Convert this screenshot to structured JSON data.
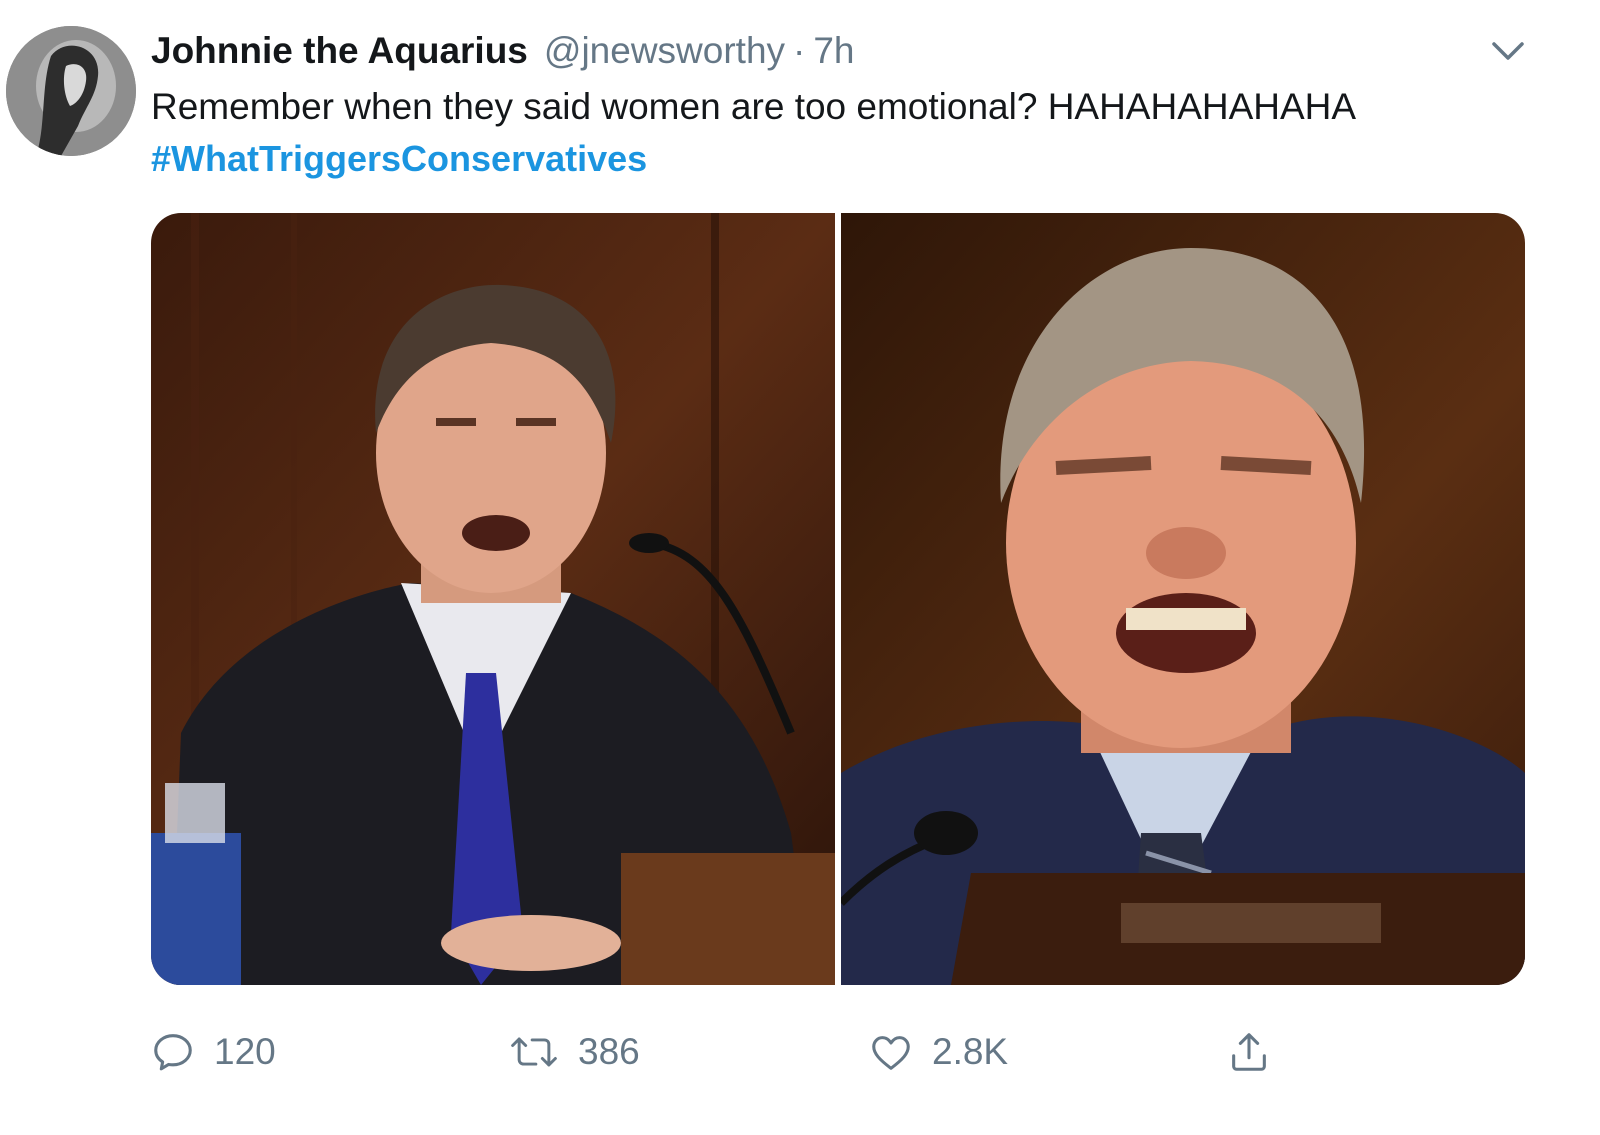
{
  "tweet": {
    "author": {
      "display_name": "Johnnie the Aquarius",
      "handle": "@jnewsworthy",
      "separator": "·",
      "time": "7h"
    },
    "text": "Remember when they said women are too emotional? HAHAHAHAHAHA",
    "hashtag": "#WhatTriggersConservatives",
    "media": [
      {
        "kind": "photo",
        "description_icon": "photo-left"
      },
      {
        "kind": "photo",
        "description_icon": "photo-right"
      }
    ],
    "actions": {
      "reply_count": "120",
      "retweet_count": "386",
      "like_count": "2.8K"
    }
  },
  "icons": {
    "reply": "reply-icon",
    "retweet": "retweet-icon",
    "like": "heart-icon",
    "share": "share-icon",
    "menu": "chevron-down-icon"
  },
  "colors": {
    "text": "#14171a",
    "secondary_text": "#657786",
    "link": "#1b95e0"
  }
}
